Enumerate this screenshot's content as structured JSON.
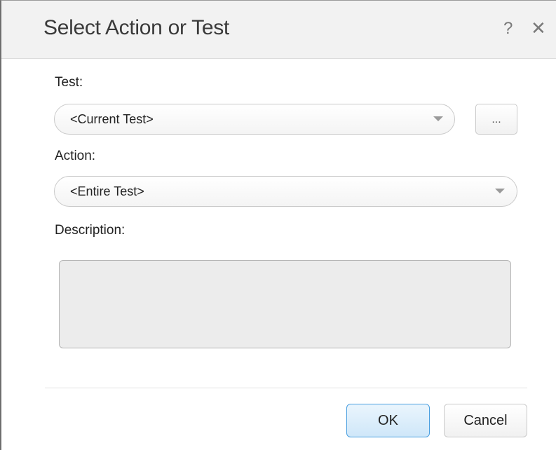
{
  "dialog": {
    "title": "Select Action or Test",
    "help_glyph": "?",
    "close_glyph": "✕"
  },
  "test": {
    "label": "Test:",
    "selected": "<Current Test>",
    "browse_label": "..."
  },
  "action": {
    "label": "Action:",
    "selected": "<Entire Test>"
  },
  "description": {
    "label": "Description:",
    "value": ""
  },
  "buttons": {
    "ok_label": "OK",
    "cancel_label": "Cancel"
  },
  "icons": [
    "help-icon",
    "close-icon",
    "chevron-down-icon"
  ],
  "colors": {
    "ok_border": "#4a9fe0",
    "ok_fill": "#cfe7f9",
    "description_fill": "#ececec"
  }
}
